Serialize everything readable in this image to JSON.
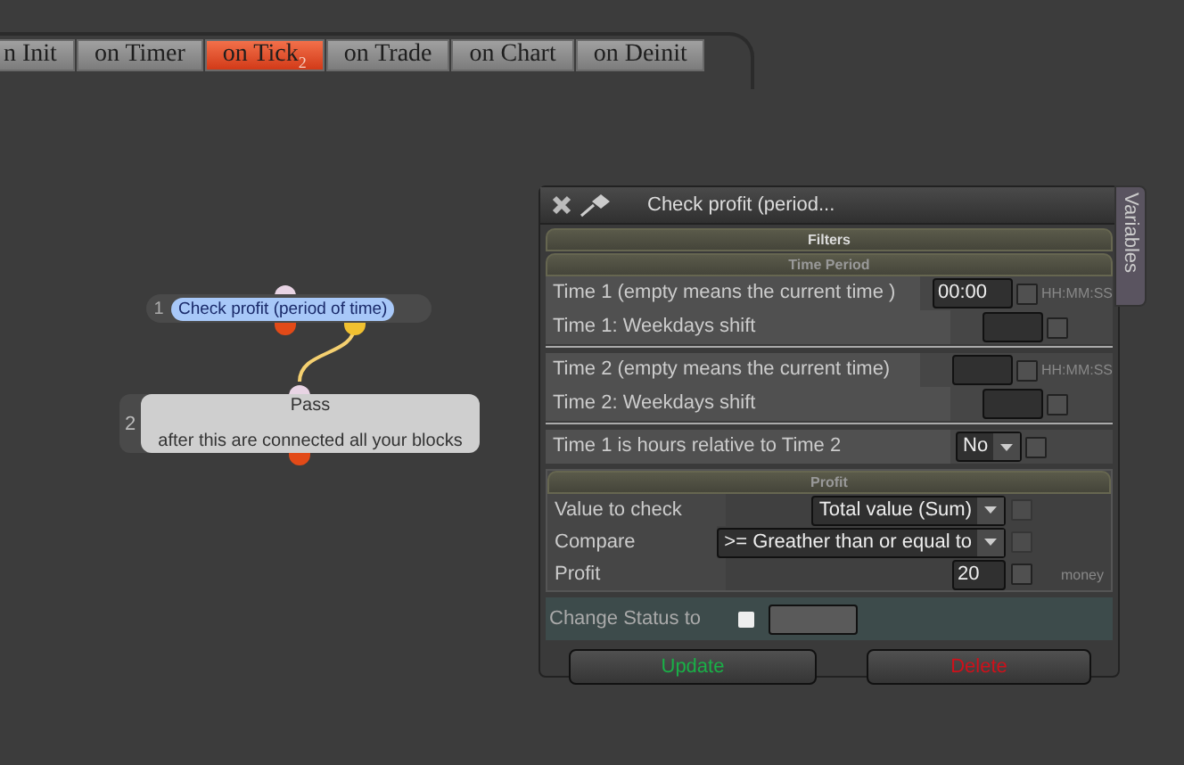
{
  "tabs": [
    {
      "label": "n Init",
      "selected": false
    },
    {
      "label": "on Timer",
      "selected": false
    },
    {
      "label": "on Tick$_{2}$",
      "selected": true
    },
    {
      "label": "on Trade",
      "selected": false
    },
    {
      "label": "on Chart",
      "selected": false
    },
    {
      "label": "on Deinit",
      "selected": false
    }
  ],
  "nodes": [
    {
      "kind": "pill",
      "number": "1",
      "title": "Check profit (period of time)"
    },
    {
      "kind": "box",
      "number": "2",
      "title": "Pass",
      "subtitle": "after this are connected all your blocks"
    }
  ],
  "dialog": {
    "title": "Check profit (period...",
    "side_tab": "Variables",
    "heading": "Filters",
    "time_period": {
      "heading": "Time Period",
      "groups": [
        [
          {
            "kind": "input",
            "label": "Time 1 (empty means the current time )",
            "value": "00:00",
            "hint": "HH:MM:SS",
            "checked": false
          },
          {
            "kind": "input",
            "label": "Time 1: Weekdays shift",
            "checked": false
          }
        ],
        [
          {
            "kind": "input",
            "label": "Time 2 (empty means the current time)",
            "hint": "HH:MM:SS",
            "checked": false
          },
          {
            "kind": "input",
            "label": "Time 2: Weekdays shift",
            "checked": false
          }
        ],
        [
          {
            "kind": "select",
            "label": "Time 1 is hours relative to Time 2",
            "value": "No",
            "checked": false
          }
        ]
      ]
    },
    "profit": {
      "heading": "Profit",
      "rows": [
        {
          "kind": "select",
          "label": "Value to check",
          "value": "Total value (Sum)",
          "checked": false
        },
        {
          "kind": "select",
          "label": "Compare",
          "value": ">= Greather than or equal to",
          "checked": false
        },
        {
          "kind": "input",
          "label": "Profit",
          "value": "20",
          "hint": "money",
          "checked": false
        }
      ]
    },
    "status": {
      "label": "Change Status to",
      "checked": false
    },
    "buttons": [
      {
        "kind": "confirm",
        "label": "Update"
      },
      {
        "kind": "danger",
        "label": "Delete"
      }
    ]
  }
}
